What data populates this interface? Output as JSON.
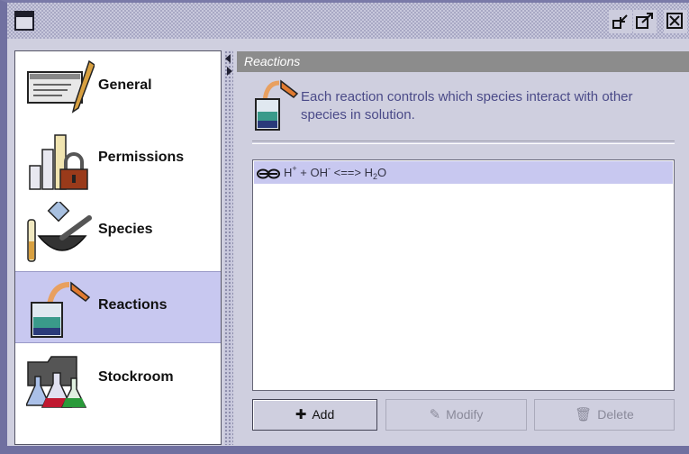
{
  "window": {
    "icons": {
      "window_menu": "window-menu-icon",
      "minimize": "minimize-icon",
      "maximize": "maximize-icon",
      "close": "close-icon"
    }
  },
  "sidebar": {
    "items": [
      {
        "label": "General",
        "icon": "notepad-pencil-icon",
        "selected": false
      },
      {
        "label": "Permissions",
        "icon": "bar-chart-lock-icon",
        "selected": false
      },
      {
        "label": "Species",
        "icon": "mortar-pestle-icon",
        "selected": false
      },
      {
        "label": "Reactions",
        "icon": "beaker-pour-icon",
        "selected": true
      },
      {
        "label": "Stockroom",
        "icon": "flasks-icon",
        "selected": false
      }
    ]
  },
  "panel": {
    "title": "Reactions",
    "description": "Each reaction controls which species interact with other species in solution.",
    "reactions": [
      {
        "lhs_1": "H",
        "lhs_1_sup": "+",
        "plus": " + ",
        "lhs_2": "OH",
        "lhs_2_sup": "-",
        "arrow": " <==> ",
        "rhs": "H",
        "rhs_sub": "2",
        "rhs_tail": "O"
      }
    ],
    "buttons": {
      "add": "Add",
      "modify": "Modify",
      "delete": "Delete"
    }
  },
  "colors": {
    "selection": "#c8c8f0",
    "panel_header": "#8c8c8c",
    "description_text": "#4a4a88"
  }
}
